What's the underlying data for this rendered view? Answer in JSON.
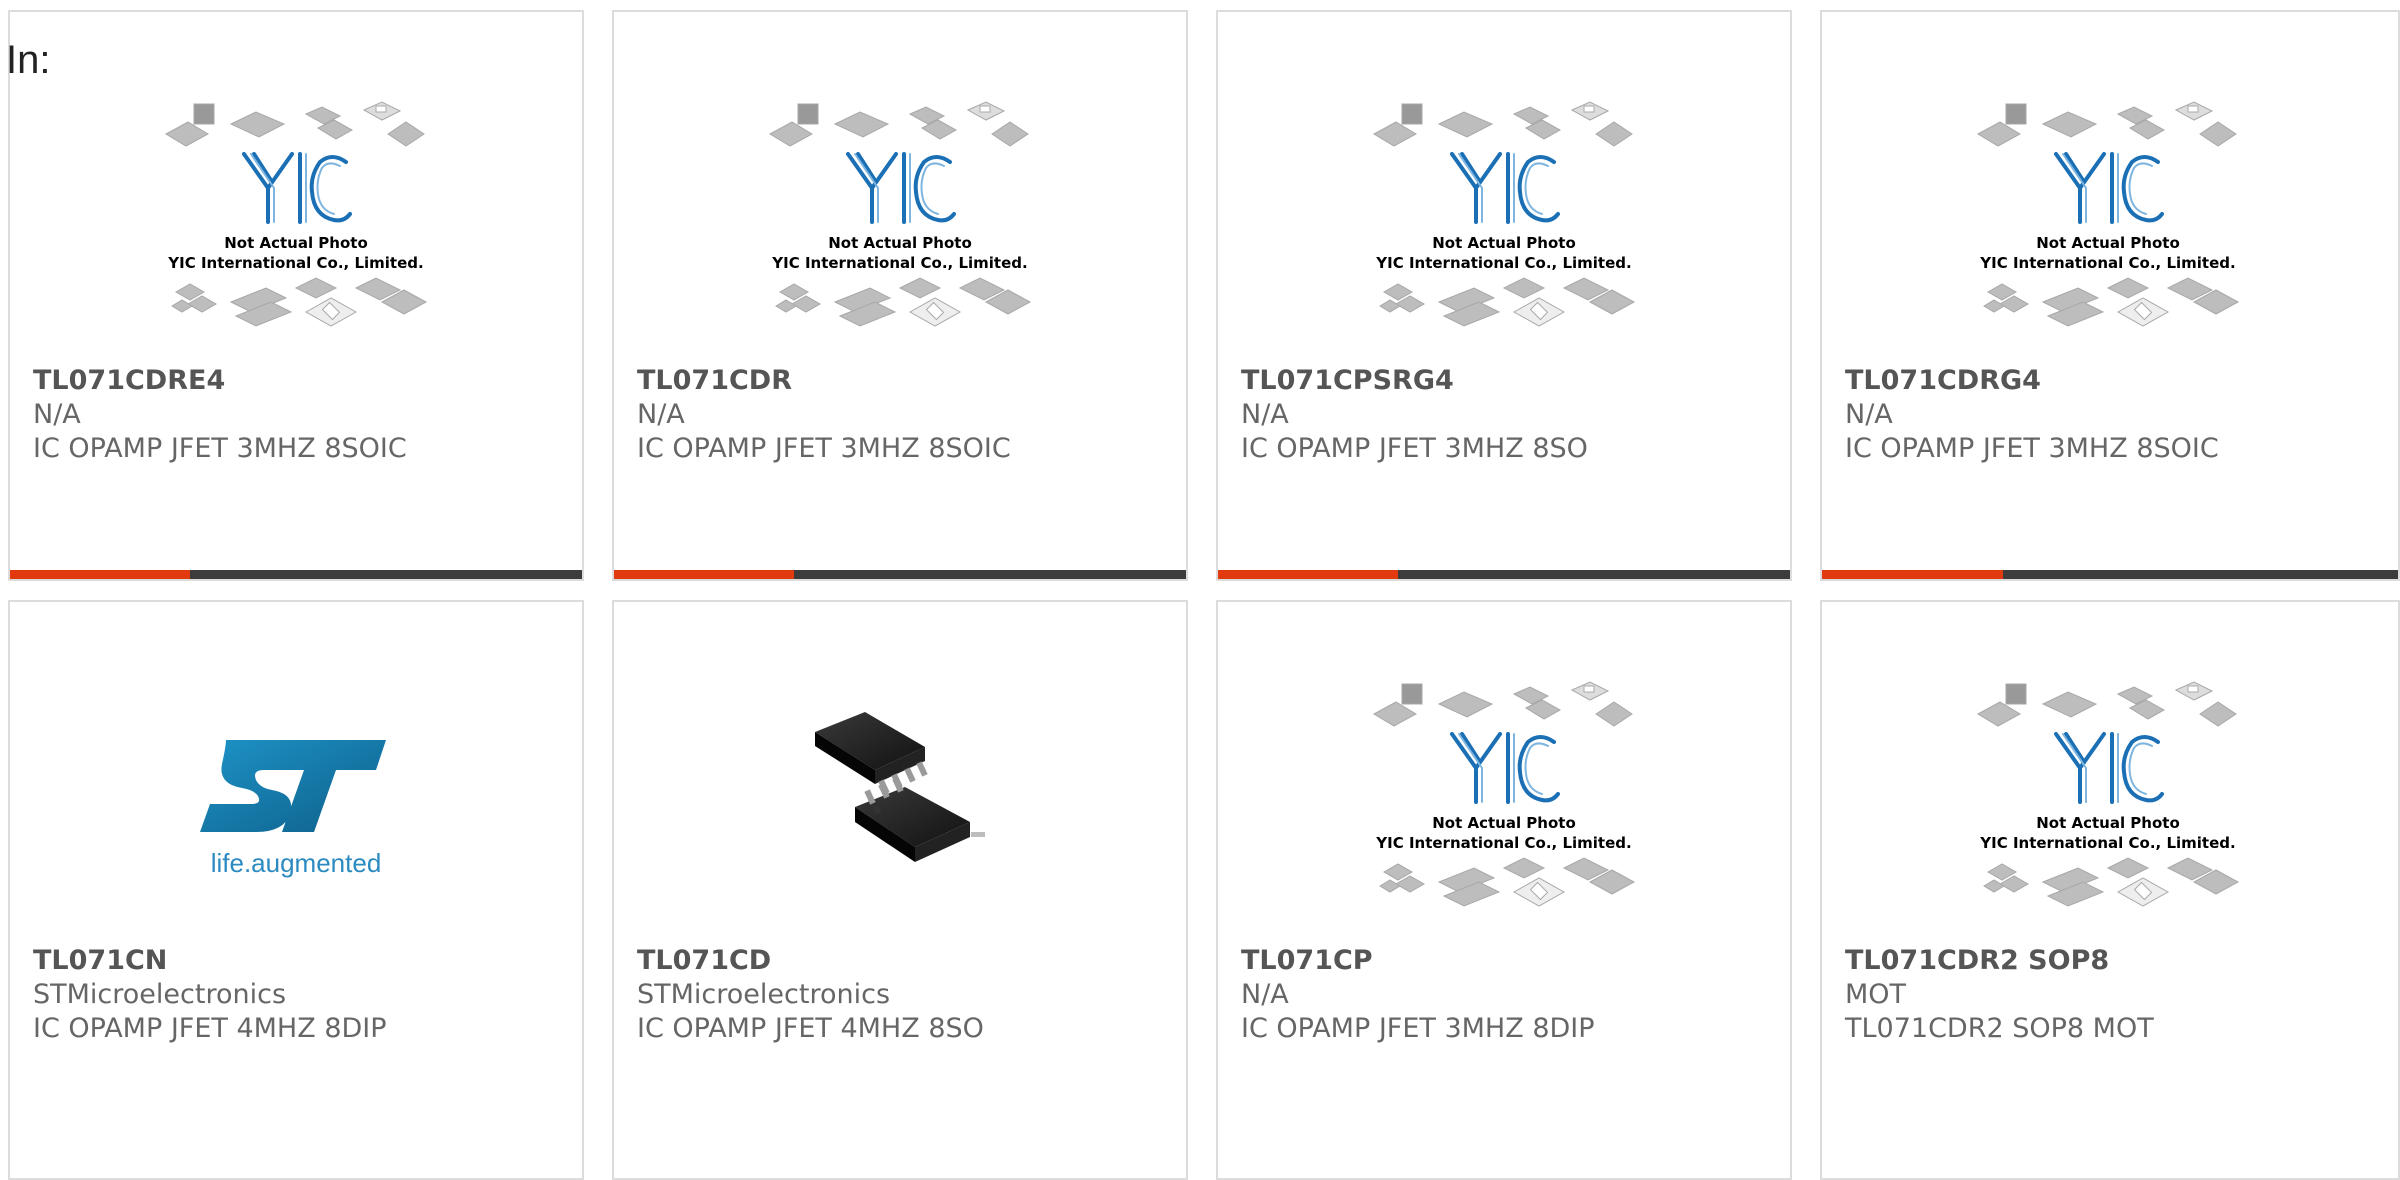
{
  "page": {
    "in_label": "In:"
  },
  "placeholder": {
    "logo": "YIC",
    "caption_line1": "Not Actual Photo",
    "caption_line2": "YIC International Co., Limited."
  },
  "st_logo": {
    "tagline": "life.augmented"
  },
  "colors": {
    "accent": "#e03a0e",
    "bar_dark": "#3c3c3c",
    "border": "#dcdcdc",
    "yic_blue": "#1a6fb5",
    "st_blue": "#1a7fb5"
  },
  "products": [
    {
      "part": "TL071CDRE4",
      "manufacturer": "N/A",
      "description": "IC OPAMP JFET 3MHZ 8SOIC",
      "image": "placeholder",
      "has_bar": true
    },
    {
      "part": "TL071CDR",
      "manufacturer": "N/A",
      "description": "IC OPAMP JFET 3MHZ 8SOIC",
      "image": "placeholder",
      "has_bar": true
    },
    {
      "part": "TL071CPSRG4",
      "manufacturer": "N/A",
      "description": "IC OPAMP JFET 3MHZ 8SO",
      "image": "placeholder",
      "has_bar": true
    },
    {
      "part": "TL071CDRG4",
      "manufacturer": "N/A",
      "description": "IC OPAMP JFET 3MHZ 8SOIC",
      "image": "placeholder",
      "has_bar": true
    },
    {
      "part": "TL071CN",
      "manufacturer": "STMicroelectronics",
      "description": "IC OPAMP JFET 4MHZ 8DIP",
      "image": "st-logo",
      "has_bar": false
    },
    {
      "part": "TL071CD",
      "manufacturer": "STMicroelectronics",
      "description": "IC OPAMP JFET 4MHZ 8SO",
      "image": "chip-photo",
      "has_bar": false
    },
    {
      "part": "TL071CP",
      "manufacturer": "N/A",
      "description": "IC OPAMP JFET 3MHZ 8DIP",
      "image": "placeholder",
      "has_bar": false
    },
    {
      "part": "TL071CDR2 SOP8",
      "manufacturer": "MOT",
      "description": "TL071CDR2 SOP8 MOT",
      "image": "placeholder",
      "has_bar": false
    }
  ]
}
